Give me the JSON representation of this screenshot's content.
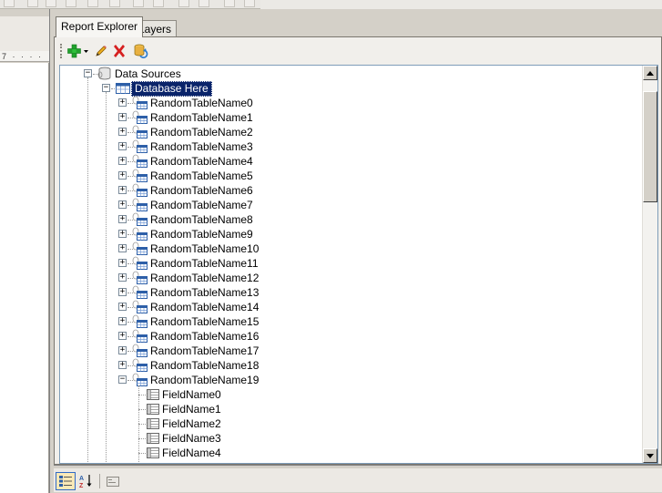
{
  "ruler": {
    "marks": "7 · · · ·"
  },
  "tabs": [
    {
      "label": "Report Explorer",
      "active": true
    },
    {
      "label": "Layers",
      "active": false
    }
  ],
  "toolbar": {
    "add_icon": "plus-green-icon",
    "edit_icon": "pencil-icon",
    "delete_icon": "red-x-icon",
    "refresh_icon": "refresh-datasource-icon"
  },
  "tree": {
    "root": {
      "label": "Data Sources",
      "expanded": true
    },
    "database": {
      "label": "Database Here",
      "expanded": true,
      "selected": true
    },
    "tables": [
      "RandomTableName0",
      "RandomTableName1",
      "RandomTableName2",
      "RandomTableName3",
      "RandomTableName4",
      "RandomTableName5",
      "RandomTableName6",
      "RandomTableName7",
      "RandomTableName8",
      "RandomTableName9",
      "RandomTableName10",
      "RandomTableName11",
      "RandomTableName12",
      "RandomTableName13",
      "RandomTableName14",
      "RandomTableName15",
      "RandomTableName16",
      "RandomTableName17",
      "RandomTableName18",
      "RandomTableName19"
    ],
    "expanded_table_index": 19,
    "fields": [
      "FieldName0",
      "FieldName1",
      "FieldName2",
      "FieldName3",
      "FieldName4"
    ]
  },
  "properties_bar": {
    "categorized_icon": "categorized-icon",
    "alphabetical_icon": "sort-az-icon",
    "pages_icon": "property-pages-icon"
  },
  "colors": {
    "selection": "#0a246a",
    "plus_green": "#22a12e",
    "delete_red": "#d62020"
  }
}
